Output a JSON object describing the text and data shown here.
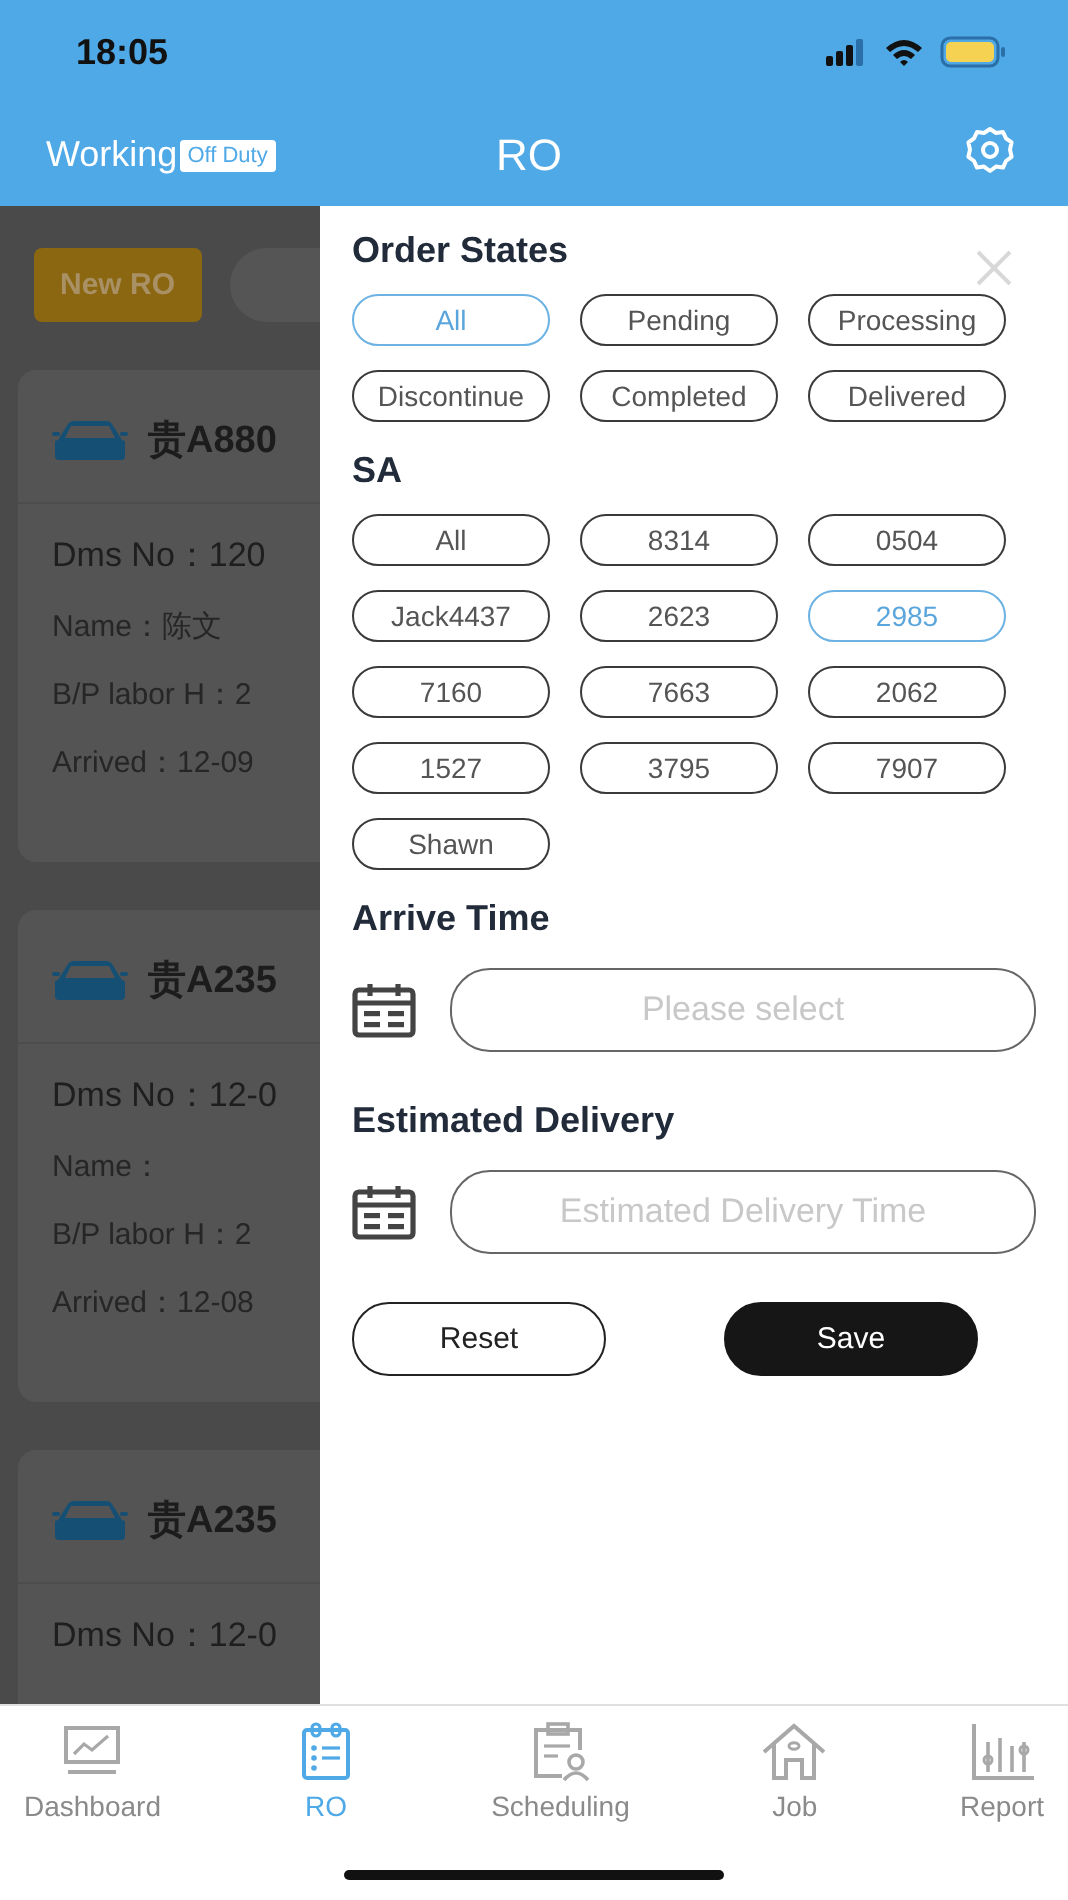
{
  "status_bar": {
    "time": "18:05"
  },
  "nav_bar": {
    "mode_label": "Working",
    "mode_badge": "Off Duty",
    "title": "RO"
  },
  "ro_list": {
    "new_button": "New RO",
    "cards": [
      {
        "plate": "贵A880",
        "fields": [
          "Dms No：120",
          "Name：陈文",
          "B/P labor H：2",
          "Arrived：12-09"
        ]
      },
      {
        "plate": "贵A235",
        "fields": [
          "Dms No：12-0",
          "Name：",
          "B/P labor H：2",
          "Arrived：12-08"
        ]
      },
      {
        "plate": "贵A235",
        "fields": [
          "Dms No：12-0"
        ]
      }
    ]
  },
  "filter_panel": {
    "order_states": {
      "title": "Order States",
      "options": [
        {
          "label": "All",
          "selected": true
        },
        {
          "label": "Pending",
          "selected": false
        },
        {
          "label": "Processing",
          "selected": false
        },
        {
          "label": "Discontinue",
          "selected": false
        },
        {
          "label": "Completed",
          "selected": false
        },
        {
          "label": "Delivered",
          "selected": false
        }
      ]
    },
    "sa": {
      "title": "SA",
      "options": [
        {
          "label": "All",
          "selected": false
        },
        {
          "label": "8314",
          "selected": false
        },
        {
          "label": "0504",
          "selected": false
        },
        {
          "label": "Jack4437",
          "selected": false
        },
        {
          "label": "2623",
          "selected": false
        },
        {
          "label": "2985",
          "selected": true
        },
        {
          "label": "7160",
          "selected": false
        },
        {
          "label": "7663",
          "selected": false
        },
        {
          "label": "2062",
          "selected": false
        },
        {
          "label": "1527",
          "selected": false
        },
        {
          "label": "3795",
          "selected": false
        },
        {
          "label": "7907",
          "selected": false
        },
        {
          "label": "Shawn",
          "selected": false
        }
      ]
    },
    "date_fields": [
      {
        "title": "Arrive Time",
        "placeholder": "Please select"
      },
      {
        "title": "Estimated Delivery",
        "placeholder": "Estimated Delivery Time"
      }
    ],
    "buttons": [
      {
        "label": "Reset",
        "kind": "outline"
      },
      {
        "label": "Save",
        "kind": "filled"
      }
    ]
  },
  "tab_bar": [
    {
      "label": "Dashboard",
      "selected": false
    },
    {
      "label": "RO",
      "selected": true
    },
    {
      "label": "Scheduling",
      "selected": false
    },
    {
      "label": "Job",
      "selected": false
    },
    {
      "label": "Report",
      "selected": false
    }
  ]
}
